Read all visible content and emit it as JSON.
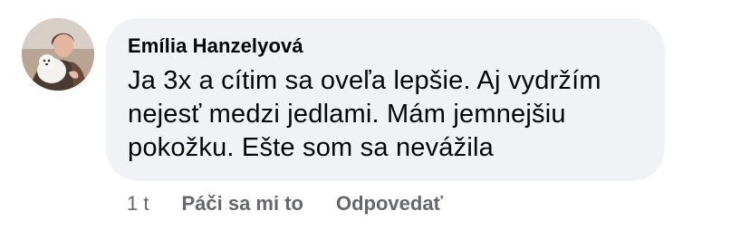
{
  "comment": {
    "author": "Emília Hanzelyová",
    "avatar_icon": "user-avatar-photo",
    "text": "Ja 3x a cítim sa oveľa lepšie. Aj vydržím nejesť medzi jedlami. Mám jemnejšiu pokožku. Ešte som sa nevážila",
    "timestamp": "1 t",
    "actions": {
      "like_label": "Páči sa mi to",
      "reply_label": "Odpovedať"
    }
  },
  "colors": {
    "bubble_background": "#f0f2f5",
    "text_primary": "#050505",
    "text_secondary": "#65676b"
  }
}
